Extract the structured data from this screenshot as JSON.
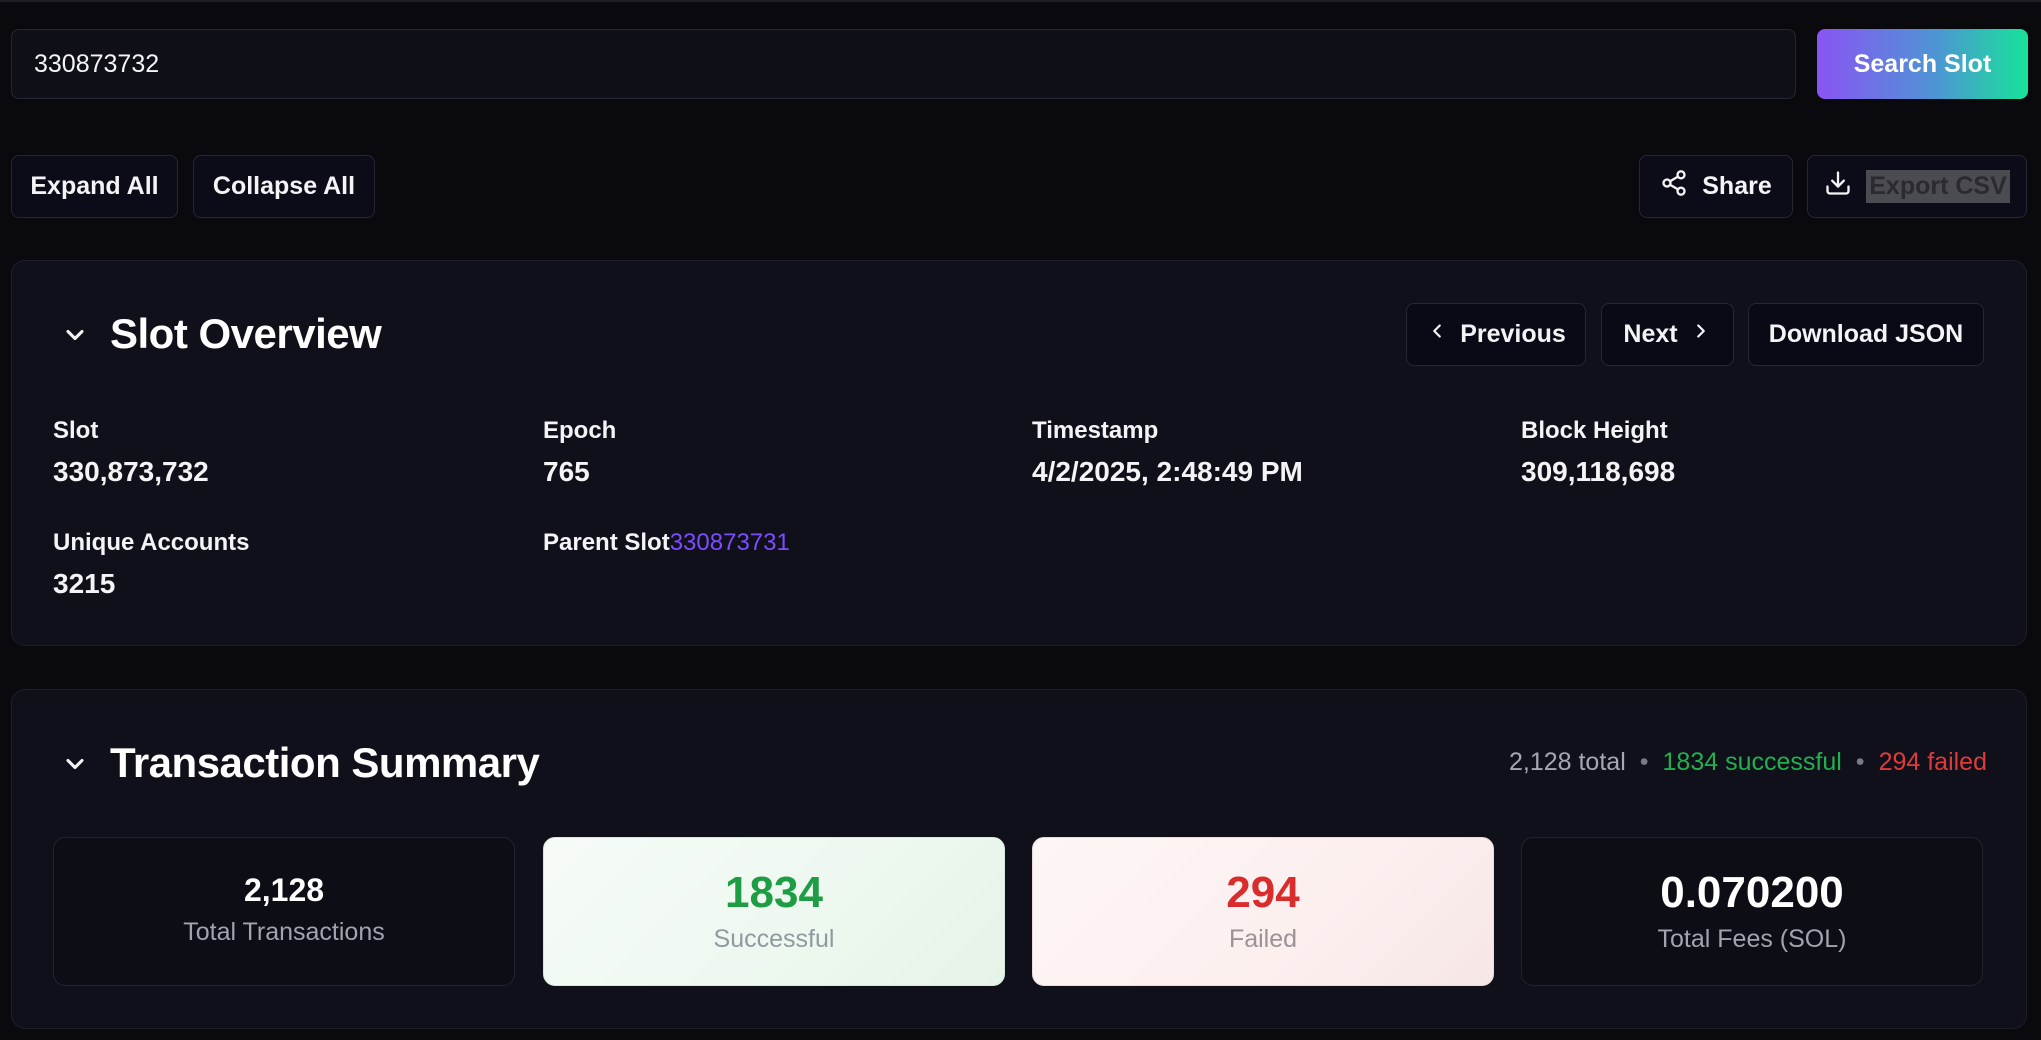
{
  "search": {
    "value": "330873732",
    "button_label": "Search Slot"
  },
  "toolbar": {
    "expand_all": "Expand All",
    "collapse_all": "Collapse All",
    "share": "Share",
    "export_csv": "Export CSV"
  },
  "slot_overview": {
    "title": "Slot Overview",
    "previous": "Previous",
    "next": "Next",
    "download_json": "Download JSON",
    "fields": {
      "slot": {
        "label": "Slot",
        "value": "330,873,732"
      },
      "epoch": {
        "label": "Epoch",
        "value": "765"
      },
      "timestamp": {
        "label": "Timestamp",
        "value": "4/2/2025, 2:48:49 PM"
      },
      "block_height": {
        "label": "Block Height",
        "value": "309,118,698"
      },
      "unique_accounts": {
        "label": "Unique Accounts",
        "value": "3215"
      },
      "parent_slot": {
        "label": "Parent Slot",
        "value": "330873731"
      }
    }
  },
  "transaction_summary": {
    "title": "Transaction Summary",
    "stats": {
      "total": "2,128 total",
      "separator": "•",
      "successful": "1834 successful",
      "failed": "294 failed"
    },
    "cards": {
      "total": {
        "value": "2,128",
        "caption": "Total Transactions"
      },
      "successful": {
        "value": "1834",
        "caption": "Successful"
      },
      "failed": {
        "value": "294",
        "caption": "Failed"
      },
      "fees": {
        "value": "0.070200",
        "caption": "Total Fees (SOL)"
      }
    }
  },
  "colors": {
    "background": "#09090e",
    "panel": "#10101a",
    "accent_purple": "#7c4dff",
    "success": "#22b04f",
    "failure": "#e03a3a"
  },
  "icons": [
    "chevron-down-icon",
    "chevron-left-icon",
    "chevron-right-icon",
    "share-icon",
    "download-icon"
  ]
}
